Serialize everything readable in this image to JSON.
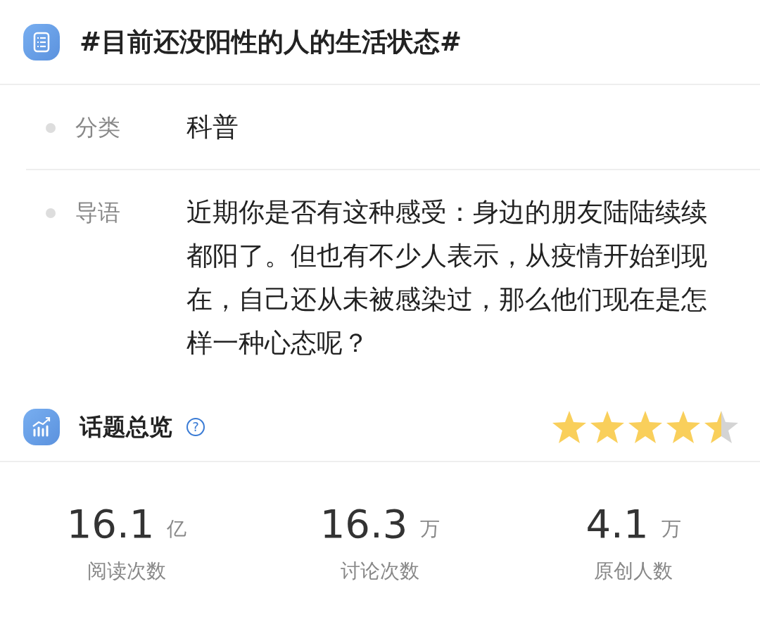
{
  "topic": {
    "title": "#目前还没阳性的人的生活状态#"
  },
  "fields": [
    {
      "label": "分类",
      "value": "科普"
    },
    {
      "label": "导语",
      "value": "近期你是否有这种感受：身边的朋友陆陆续续都阳了。但也有不少人表示，从疫情开始到现在，自己还从未被感染过，那么他们现在是怎样一种心态呢？"
    }
  ],
  "overview": {
    "title": "话题总览",
    "help": "?",
    "stars": 4.5
  },
  "stats": [
    {
      "number": "16.1",
      "unit": "亿",
      "label": "阅读次数"
    },
    {
      "number": "16.3",
      "unit": "万",
      "label": "讨论次数"
    },
    {
      "number": "4.1",
      "unit": "万",
      "label": "原创人数"
    }
  ]
}
